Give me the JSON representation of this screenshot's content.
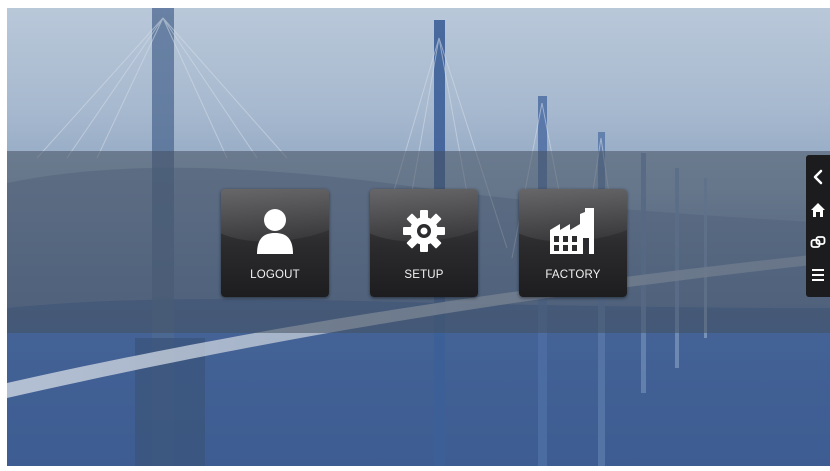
{
  "screen": {
    "tiles": [
      {
        "label": "LOGOUT",
        "icon": "user-icon"
      },
      {
        "label": "SETUP",
        "icon": "gear-icon"
      },
      {
        "label": "FACTORY",
        "icon": "factory-icon"
      }
    ],
    "side_rail": {
      "items": [
        {
          "icon": "chevron-left-icon"
        },
        {
          "icon": "home-icon"
        },
        {
          "icon": "link-icon"
        },
        {
          "icon": "menu-icon"
        }
      ]
    }
  },
  "colors": {
    "tile_bg": "#2c2c2e",
    "label_text": "#f2f2f2",
    "rail_bg": "#1c1c1e"
  }
}
